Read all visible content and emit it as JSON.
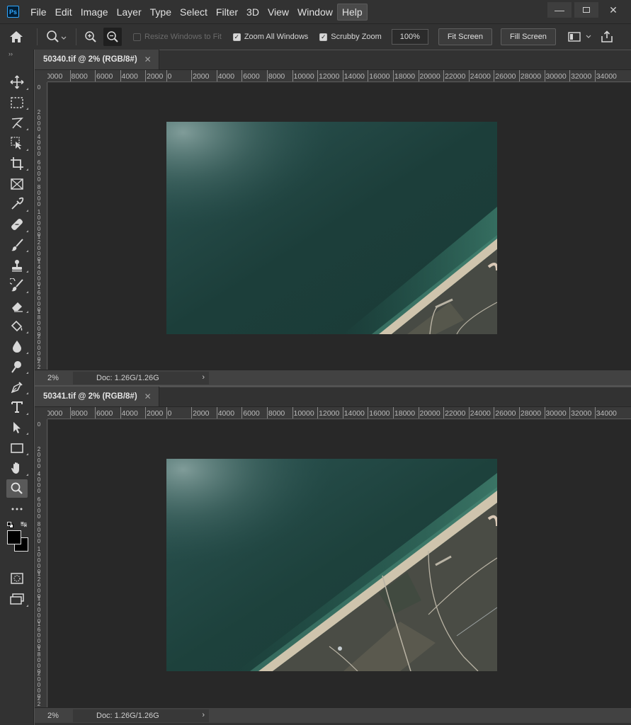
{
  "app": {
    "logo": "Ps"
  },
  "menu": [
    "File",
    "Edit",
    "Image",
    "Layer",
    "Type",
    "Select",
    "Filter",
    "3D",
    "View",
    "Window",
    "Help"
  ],
  "options": {
    "resize_windows": "Resize Windows to Fit",
    "zoom_all": "Zoom All Windows",
    "scrubby_zoom": "Scrubby Zoom",
    "zoom_value": "100%",
    "fit_screen": "Fit Screen",
    "fill_screen": "Fill Screen"
  },
  "toolbar": {
    "collapse": "››",
    "tools": [
      "move-tool",
      "marquee-tool",
      "lasso-tool",
      "object-select-tool",
      "crop-tool",
      "frame-tool",
      "eyedropper-tool",
      "healing-brush-tool",
      "brush-tool",
      "clone-stamp-tool",
      "history-brush-tool",
      "eraser-tool",
      "paint-bucket-tool",
      "blur-tool",
      "dodge-tool",
      "pen-tool",
      "type-tool",
      "path-select-tool",
      "rectangle-tool",
      "hand-tool",
      "zoom-tool",
      "more-tools"
    ],
    "selected": "zoom-tool"
  },
  "documents": [
    {
      "title": "50340.tif @ 2% (RGB/8#)",
      "zoom": "2%",
      "doc_size": "Doc: 1.26G/1.26G",
      "scene": "shore-top"
    },
    {
      "title": "50341.tif @ 2% (RGB/8#)",
      "zoom": "2%",
      "doc_size": "Doc: 1.26G/1.26G",
      "scene": "shore-bottom"
    }
  ],
  "ruler": {
    "h_labels": [
      "0000",
      "8000",
      "6000",
      "4000",
      "2000",
      "0",
      "2000",
      "4000",
      "6000",
      "8000",
      "10000",
      "12000",
      "14000",
      "16000",
      "18000",
      "20000",
      "22000",
      "24000",
      "26000",
      "28000",
      "30000",
      "32000",
      "34000"
    ],
    "v_labels": [
      "0",
      "2000",
      "4000",
      "6000",
      "8000",
      "10000",
      "12000",
      "14000",
      "16000",
      "18000",
      "20000",
      "22000"
    ]
  },
  "colors": {
    "foreground": "#000000",
    "background": "#000000",
    "canvas": "#282828",
    "panel": "#323232"
  }
}
